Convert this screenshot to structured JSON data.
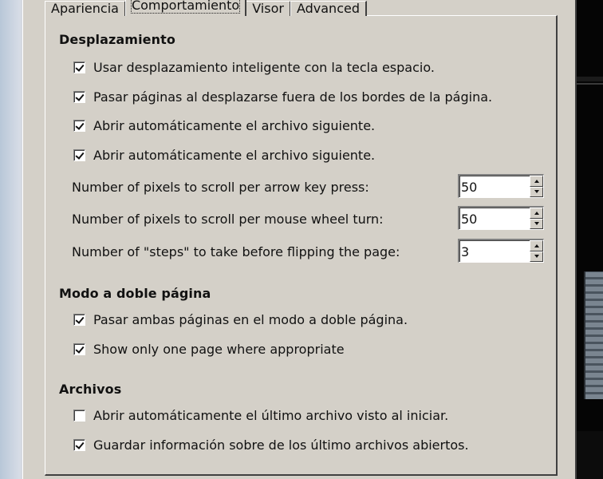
{
  "tabs": [
    {
      "label": "Apariencia",
      "active": false
    },
    {
      "label": "Comportamiento",
      "active": true
    },
    {
      "label": "Visor",
      "active": false
    },
    {
      "label": "Advanced",
      "active": false
    }
  ],
  "scrolling": {
    "title": "Desplazamiento",
    "options": [
      {
        "label": "Usar desplazamiento inteligente con la tecla espacio.",
        "checked": true
      },
      {
        "label": "Pasar páginas al desplazarse fuera de los bordes de la página.",
        "checked": true
      },
      {
        "label": "Abrir automáticamente el archivo siguiente.",
        "checked": true
      },
      {
        "label": "Abrir automáticamente el archivo siguiente.",
        "checked": true
      }
    ],
    "fields": [
      {
        "label": "Number of pixels to scroll per arrow key press:",
        "value": "50"
      },
      {
        "label": "Number of pixels to scroll per mouse wheel turn:",
        "value": "50"
      },
      {
        "label": "Number of \"steps\" to take before flipping the page:",
        "value": "3"
      }
    ]
  },
  "double_page": {
    "title": "Modo a doble página",
    "options": [
      {
        "label": "Pasar ambas páginas en el modo a doble página.",
        "checked": true
      },
      {
        "label": "Show only one page where appropriate",
        "checked": true
      }
    ]
  },
  "files": {
    "title": "Archivos",
    "options": [
      {
        "label": "Abrir automáticamente el último archivo visto al iniciar.",
        "checked": false
      },
      {
        "label": "Guardar información sobre de los último archivos abiertos.",
        "checked": true
      }
    ]
  }
}
